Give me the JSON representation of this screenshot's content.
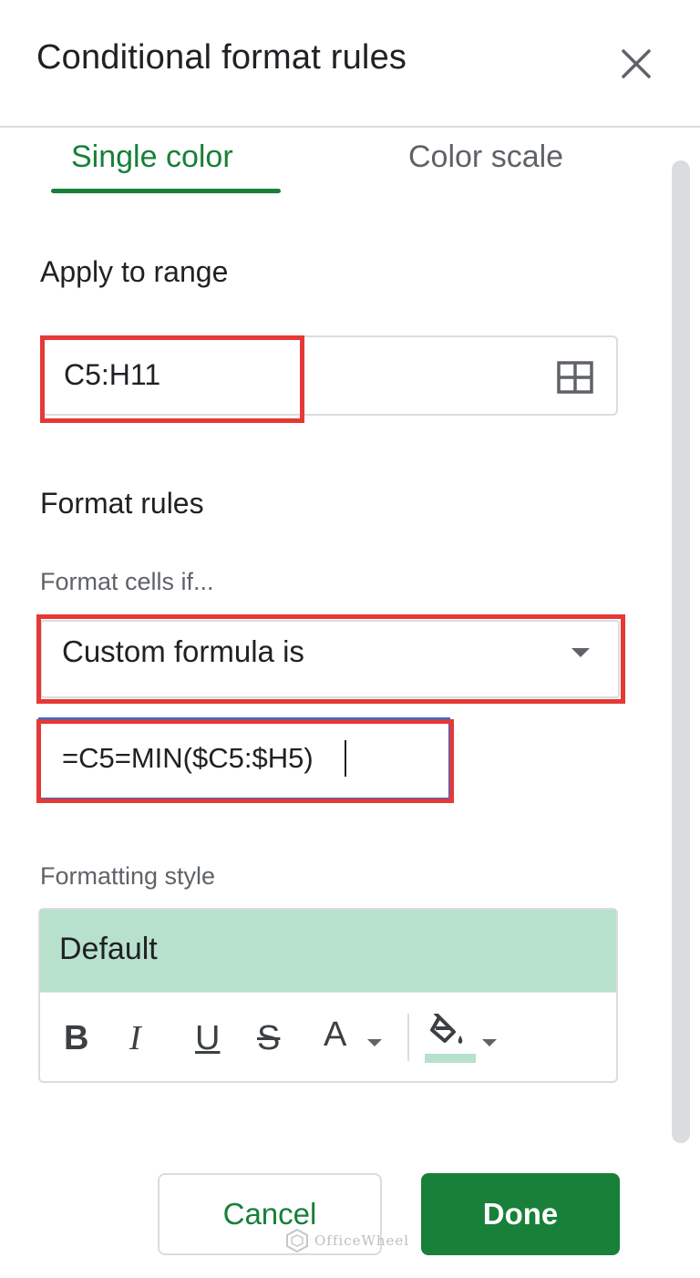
{
  "dialog": {
    "title": "Conditional format rules",
    "close_icon": "close-icon"
  },
  "tabs": [
    {
      "label": "Single color",
      "active": true
    },
    {
      "label": "Color scale",
      "active": false
    }
  ],
  "apply_range": {
    "label": "Apply to range",
    "value": "C5:H11",
    "icon": "select-range-grid-icon"
  },
  "format_rules": {
    "label": "Format rules",
    "condition_label": "Format cells if...",
    "condition_value": "Custom formula is",
    "formula_value": "=C5=MIN($C5:$H5)"
  },
  "formatting_style": {
    "label": "Formatting style",
    "preview_label": "Default",
    "preview_fill": "#b7e1cd",
    "toolbar": {
      "bold": "B",
      "italic": "I",
      "underline": "U",
      "strikethrough": "S",
      "text_color": "A"
    }
  },
  "buttons": {
    "cancel": "Cancel",
    "done": "Done"
  },
  "colors": {
    "accent_green": "#188038",
    "highlight_red": "#e53935",
    "focus_blue": "#1a73e8"
  },
  "watermark": {
    "text": "OfficeWheel"
  }
}
